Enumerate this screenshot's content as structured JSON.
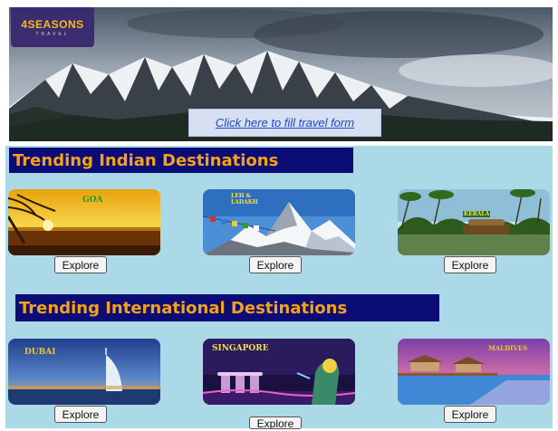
{
  "logo": {
    "brand": "4SEASONS",
    "tagline": "TRAVEL"
  },
  "hero": {
    "form_link": "Click here to fill travel form"
  },
  "sections": [
    {
      "title": "Trending Indian Destinations",
      "destinations": [
        {
          "name": "GOA",
          "button": "Explore"
        },
        {
          "name": "LEH & LADAKH",
          "button": "Explore"
        },
        {
          "name": "KERALA",
          "button": "Explore"
        }
      ]
    },
    {
      "title": "Trending International Destinations",
      "destinations": [
        {
          "name": "DUBAI",
          "button": "Explore"
        },
        {
          "name": "SINGAPORE",
          "button": "Explore"
        },
        {
          "name": "MALDIVES",
          "button": "Explore"
        }
      ]
    }
  ],
  "colors": {
    "panel_background": "#acd9e8",
    "title_background": "#0c0c76",
    "title_text": "#f5a21a",
    "link": "#1a4cc9"
  },
  "icons": [
    "mountain-scene",
    "beach-sunset-image",
    "himalaya-image",
    "backwater-image",
    "burj-al-arab-image",
    "merlion-image",
    "overwater-villa-image"
  ]
}
